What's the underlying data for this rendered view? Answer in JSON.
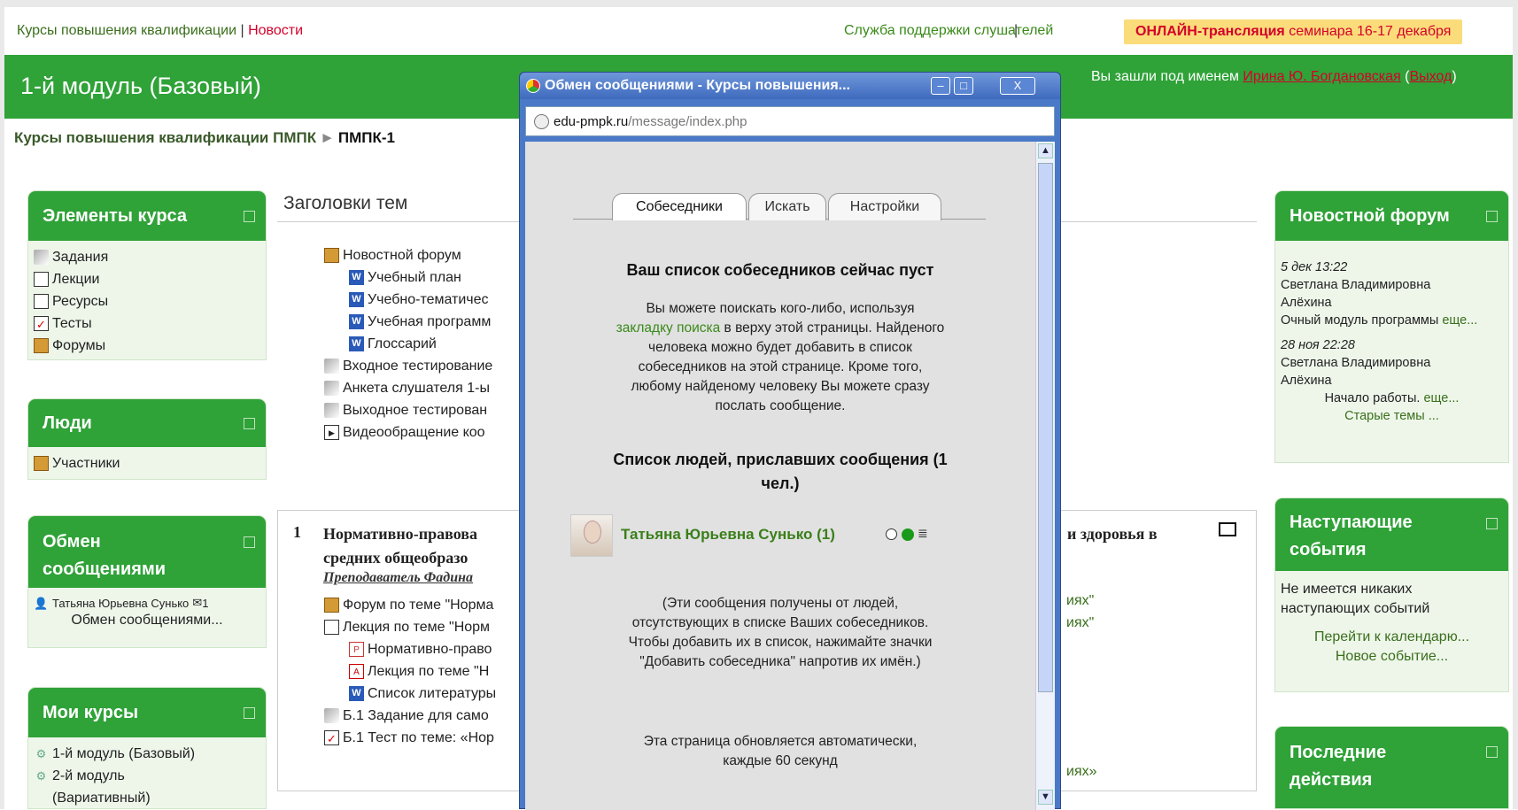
{
  "topbar": {
    "courses": "Курсы повышения квалификации",
    "sep": " | ",
    "news": "Новости",
    "support": "Служба поддержки слушателей",
    "support_sep": "|",
    "online_bold": "ОНЛАЙН-трансляция",
    "online_rest": " семинара 16-17 декабря"
  },
  "header": {
    "title": "1-й модуль (Базовый)",
    "login_prefix": "Вы зашли под именем ",
    "user": "Ирина Ю. Богдановская",
    "paren_open": " (",
    "logout": "Выход",
    "paren_close": ")"
  },
  "breadcrumb": {
    "root": "Курсы повышения квалификации ПМПК",
    "sep": "►",
    "current": "ПМПК-1"
  },
  "left_blocks": {
    "course_elements": {
      "title": "Элементы курса",
      "items": [
        "Задания",
        "Лекции",
        "Ресурсы",
        "Тесты",
        "Форумы"
      ]
    },
    "people": {
      "title": "Люди",
      "items": [
        "Участники"
      ]
    },
    "messaging": {
      "title_line1": "Обмен",
      "title_line2": "сообщениями",
      "contact": "Татьяна Юрьевна Сунько",
      "count": "1",
      "link": "Обмен сообщениями..."
    },
    "my_courses": {
      "title": "Мои курсы",
      "items": [
        "1-й модуль (Базовый)",
        "2-й модуль",
        "(Вариативный)"
      ]
    }
  },
  "main": {
    "title": "Заголовки тем",
    "items": [
      "Новостной форум",
      "Учебный план",
      "Учебно-тематичес",
      "Учебная программ",
      "Глоссарий",
      "Входное тестирование",
      "Анкета слушателя 1-ы",
      "Выходное тестирован",
      "Видеообращение коо"
    ],
    "topic": {
      "num": "1",
      "title_a": "Нормативно-правова",
      "title_b": "и здоровья в",
      "title_line2": "средних общеобразо",
      "teacher": "Преподаватель Фадина",
      "items": [
        "Форум по теме \"Норма",
        "Лекция по теме \"Норм",
        "Нормативно-право",
        "Лекция по теме \"Н",
        "Список литературы",
        "Б.1 Задание для само",
        "Б.1 Тест по теме: «Нор"
      ],
      "tail1": "иях\"",
      "tail2": "иях\"",
      "tail3": "иях»"
    }
  },
  "popup": {
    "title": "Обмен сообщениями - Курсы повышения...",
    "url_host": "edu-pmpk.ru",
    "url_path": "/message/index.php",
    "tabs": [
      "Собеседники",
      "Искать",
      "Настройки"
    ],
    "empty_heading": "Ваш список собеседников сейчас пуст",
    "p1_line1": "Вы можете поискать кого-либо, используя",
    "p1_link": "закладку поиска",
    "p1_line2_rest": " в верху этой страницы. Найденого",
    "p1_line3": "человека можно будет добавить в список",
    "p1_line4": "собеседников на этой странице. Кроме того,",
    "p1_line5": "любому найденому человеку Вы можете сразу",
    "p1_line6": "послать сообщение.",
    "senders_heading_1": "Список людей, приславших сообщения (1",
    "senders_heading_2": "чел.)",
    "sender_name": "Татьяна Юрьевна Сунько (1)",
    "note_1": "(Эти сообщения получены от людей,",
    "note_2": "отсутствующих в списке Ваших собеседников.",
    "note_3": "Чтобы добавить их в список, нажимайте значки",
    "note_4": "\"Добавить собеседника\" напротив их имён.)",
    "refresh_1": "Эта страница обновляется автоматически,",
    "refresh_2": "каждые 60 секунд"
  },
  "right_blocks": {
    "news_forum": {
      "title": "Новостной форум",
      "post1_date": "5 дек 13:22",
      "post1_author1": "Светлана Владимировна",
      "post1_author2": "Алёхина",
      "post1_text": "Очный модуль программы ",
      "post1_more": "еще...",
      "post2_date": "28 ноя 22:28",
      "post2_author1": "Светлана Владимировна",
      "post2_author2": "Алёхина",
      "post2_text": "Начало работы. ",
      "post2_more": "еще...",
      "old": "Старые темы ..."
    },
    "upcoming": {
      "title_line1": "Наступающие",
      "title_line2": "события",
      "text1": "Не имеется никаких",
      "text2": "наступающих событий",
      "calendar": "Перейти к календарю...",
      "new_event": "Новое событие..."
    },
    "recent": {
      "title_line1": "Последние",
      "title_line2": "действия"
    }
  }
}
